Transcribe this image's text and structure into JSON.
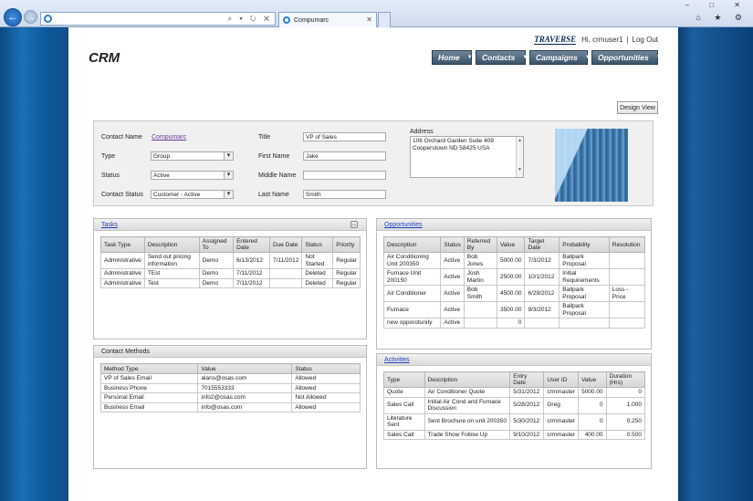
{
  "browser": {
    "tab_title": "Compumarc",
    "window_buttons": "– □ ✕",
    "tool_icons": "⌂ ★ ⚙",
    "addr_tools": "⌕ ▾ ↻ ✕"
  },
  "header": {
    "brand": "TRAVERSE",
    "greeting": "Hi, crmuser1",
    "separator": "|",
    "logout": "Log Out",
    "title": "CRM",
    "menu": [
      {
        "label": "Home"
      },
      {
        "label": "Contacts"
      },
      {
        "label": "Campaigns"
      },
      {
        "label": "Opportunities"
      }
    ],
    "design_view": "Design View"
  },
  "contact": {
    "name_label": "Contact Name",
    "name_value": "Compumarc",
    "type_label": "Type",
    "type_value": "Group",
    "status_label": "Status",
    "status_value": "Active",
    "contact_status_label": "Contact Status",
    "contact_status_value": "Customer - Active",
    "title_label": "Title",
    "title_value": "VP of Sales",
    "first_name_label": "First Name",
    "first_name_value": "Jake",
    "middle_name_label": "Middle Name",
    "middle_name_value": "",
    "last_name_label": "Last Name",
    "last_name_value": "Smith",
    "address_label": "Address",
    "address_line1": "106 Orchard Garden Suite 409",
    "address_line2": "Cooperstown ND 58425 USA"
  },
  "tasks": {
    "title": "Tasks",
    "columns": [
      "Task Type",
      "Description",
      "Assigned To",
      "Entered Date",
      "Due Date",
      "Status",
      "Priority"
    ],
    "rows": [
      [
        "Administrative",
        "Send out pricing information",
        "Demo",
        "6/13/2012",
        "7/11/2012",
        "Not Started",
        "Regular"
      ],
      [
        "Administrative",
        "TEst",
        "Demo",
        "7/11/2012",
        "",
        "Deleted",
        "Regular"
      ],
      [
        "Administrative",
        "Test",
        "Demo",
        "7/11/2012",
        "",
        "Deleted",
        "Regular"
      ]
    ]
  },
  "opportunities": {
    "title": "Opportunities",
    "columns": [
      "Description",
      "Status",
      "Referred By",
      "Value",
      "Target Date",
      "Probability",
      "Resolution"
    ],
    "rows": [
      [
        "Air Conditioning Unit 200350",
        "Active",
        "Bob Jones",
        "5000.00",
        "7/3/2012",
        "Ballpark Proposal",
        ""
      ],
      [
        "Furnace Unit 200150",
        "Active",
        "Josh Martin",
        "2500.00",
        "10/1/2012",
        "Initial Requirements",
        ""
      ],
      [
        "Air Conditioner",
        "Active",
        "Bob Smith",
        "4500.00",
        "6/29/2012",
        "Ballpark Proposal",
        "Loss - Price"
      ],
      [
        "Furnace",
        "Active",
        "",
        "3500.00",
        "9/3/2012",
        "Ballpark Proposal",
        ""
      ],
      [
        "new opporotunity",
        "Active",
        "",
        "0",
        "",
        "",
        ""
      ]
    ]
  },
  "contact_methods": {
    "title": "Contact Methods",
    "columns": [
      "Method Type",
      "Value",
      "Status"
    ],
    "rows": [
      [
        "VP of Sales Email",
        "alans@osas.com",
        "Allowed"
      ],
      [
        "Business Phone",
        "7015553333",
        "Allowed"
      ],
      [
        "Personal Email",
        "info2@osas.com",
        "Not Allowed"
      ],
      [
        "Business Email",
        "info@osas.com",
        "Allowed"
      ]
    ]
  },
  "activities": {
    "title": "Activities",
    "columns": [
      "Type",
      "Description",
      "Entry Date",
      "User ID",
      "Value",
      "Duration (Hrs)"
    ],
    "rows": [
      [
        "Quote",
        "Air Conditioner Quote",
        "5/31/2012",
        "crmmaster",
        "5000.00",
        "0"
      ],
      [
        "Sales Call",
        "Initial Air Cond and Furnace Discussion",
        "5/28/2012",
        "Greg",
        "0",
        "1.000"
      ],
      [
        "Literature Sent",
        "Sent Brochure on unit 200350",
        "5/30/2012",
        "crmmaster",
        "0",
        "0.250"
      ],
      [
        "Sales Call",
        "Trade Show Follow Up",
        "9/10/2012",
        "crmmaster",
        "400.00",
        "0.500"
      ]
    ]
  },
  "colors": {
    "menu_bg": "#4f667a",
    "link": "#2244bb",
    "contact_link": "#6a3a8f"
  }
}
